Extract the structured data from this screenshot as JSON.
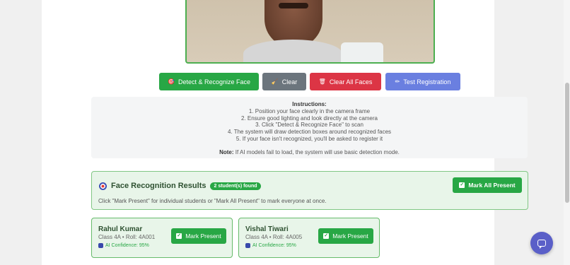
{
  "buttons": {
    "detect": "Detect & Recognize Face",
    "clear": "Clear",
    "clear_all": "Clear All Faces",
    "test_registration": "Test Registration"
  },
  "instructions": {
    "title": "Instructions:",
    "steps": [
      "1. Position your face clearly in the camera frame",
      "2. Ensure good lighting and look directly at the camera",
      "3. Click \"Detect & Recognize Face\" to scan",
      "4. The system will draw detection boxes around recognized faces",
      "5. If your face isn't recognized, you'll be asked to register it"
    ],
    "note_label": "Note:",
    "note_text": " If AI models fail to load, the system will use basic detection mode."
  },
  "results": {
    "title": "Face Recognition Results",
    "badge": "2 student(s) found",
    "hint": "Click \"Mark Present\" for individual students or \"Mark All Present\" to mark everyone at once.",
    "mark_all": "Mark All Present"
  },
  "students": [
    {
      "name": "Rahul Kumar",
      "meta": "Class 4A • Roll: 4A001",
      "confidence": "AI Confidence: 95%",
      "button": "Mark Present"
    },
    {
      "name": "Vishal Tiwari",
      "meta": "Class 4A • Roll: 4A005",
      "confidence": "AI Confidence: 95%",
      "button": "Mark Present"
    }
  ],
  "icons": {
    "detect": "target-icon",
    "clear": "broom-icon",
    "clear_all": "trash-icon",
    "test": "pencil-icon",
    "results": "target-icon",
    "confidence": "robot-icon",
    "chat": "chat-icon"
  },
  "colors": {
    "success": "#28a745",
    "secondary": "#6c757d",
    "danger": "#dc3545",
    "primary": "#6a7fe0",
    "chat": "#5a5fc8"
  }
}
